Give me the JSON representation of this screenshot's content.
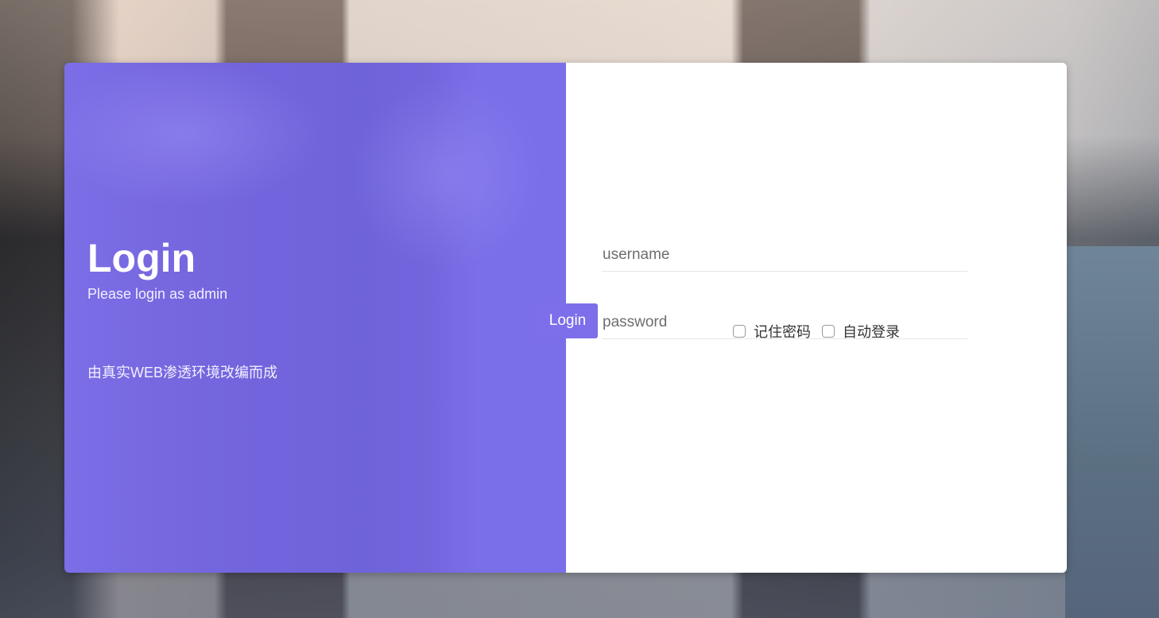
{
  "left_panel": {
    "title": "Login",
    "subtitle": "Please login as admin",
    "note": "由真实WEB渗透环境改编而成",
    "background_color": "#7366de"
  },
  "form": {
    "username": {
      "placeholder": "username",
      "value": ""
    },
    "password": {
      "placeholder": "password",
      "value": ""
    },
    "login_button_label": "Login",
    "remember_password": {
      "label": "记住密码",
      "checked": false
    },
    "auto_login": {
      "label": "自动登录",
      "checked": false
    },
    "accent_color": "#7d6ee9"
  }
}
